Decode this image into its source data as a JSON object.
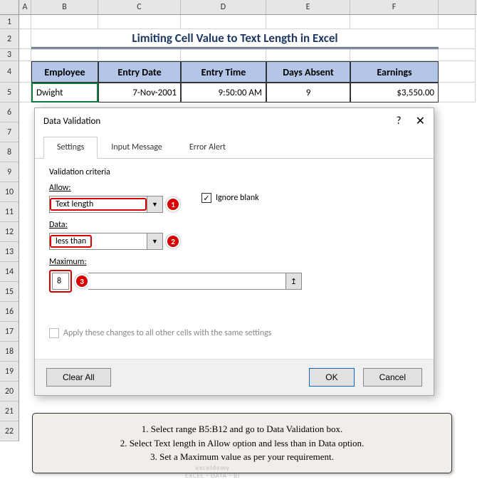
{
  "columns": [
    "A",
    "B",
    "C",
    "D",
    "E",
    "F"
  ],
  "rows": [
    "1",
    "2",
    "3",
    "4",
    "5",
    "6",
    "7",
    "8",
    "9",
    "10",
    "11",
    "12",
    "13",
    "14",
    "15",
    "16",
    "17",
    "18",
    "19",
    "20",
    "21",
    "22"
  ],
  "title": "Limiting Cell Value to Text Length in Excel",
  "table": {
    "headers": [
      "Employee",
      "Entry Date",
      "Entry Time",
      "Days Absent",
      "Earnings"
    ],
    "row1": [
      "Dwight",
      "7-Nov-2001",
      "9:50:00 AM",
      "9",
      "$3,550.00"
    ]
  },
  "dialog": {
    "title": "Data Validation",
    "help": "?",
    "tabs": [
      "Settings",
      "Input Message",
      "Error Alert"
    ],
    "criteria_label": "Validation criteria",
    "allow_label": "Allow:",
    "allow_value": "Text length",
    "ignore_blank": "Ignore blank",
    "data_label": "Data:",
    "data_value": "less than",
    "max_label": "Maximum:",
    "max_value": "8",
    "apply_label": "Apply these changes to all other cells with the same settings",
    "clear": "Clear All",
    "ok": "OK",
    "cancel": "Cancel"
  },
  "badges": {
    "b1": "1",
    "b2": "2",
    "b3": "3"
  },
  "instructions": {
    "l1": "1. Select range B5:B12 and go to Data Validation box.",
    "l2": "2. Select Text length in Allow option and less than in Data option.",
    "l3": "3. Set a Maximum value as per your requirement."
  },
  "watermark": {
    "l1": "exceldemy",
    "l2": "EXCEL · DATA · BI"
  }
}
